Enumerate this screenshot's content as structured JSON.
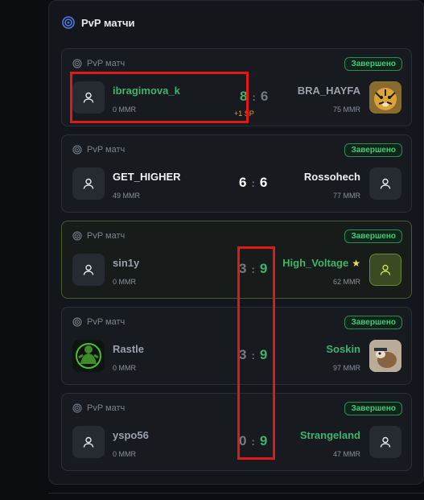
{
  "panel": {
    "title": "PvP матчи"
  },
  "matches": [
    {
      "type_label": "PvP матч",
      "status": "Завершено",
      "left": {
        "name": "ibragimova_k",
        "mmr": "0 MMR",
        "score": "8",
        "bonus": "+1 SP"
      },
      "right": {
        "name": "BRA_HAYFA",
        "mmr": "75 MMR",
        "score": "6"
      }
    },
    {
      "type_label": "PvP матч",
      "status": "Завершено",
      "left": {
        "name": "GET_HIGHER",
        "mmr": "49 MMR",
        "score": "6"
      },
      "right": {
        "name": "Rossohech",
        "mmr": "77 MMR",
        "score": "6"
      }
    },
    {
      "type_label": "PvP матч",
      "status": "Завершено",
      "left": {
        "name": "sin1y",
        "mmr": "0 MMR",
        "score": "3"
      },
      "right": {
        "name": "High_Voltage",
        "mmr": "62 MMR",
        "score": "9"
      }
    },
    {
      "type_label": "PvP матч",
      "status": "Завершено",
      "left": {
        "name": "Rastle",
        "mmr": "0 MMR",
        "score": "3"
      },
      "right": {
        "name": "Soskin",
        "mmr": "97 MMR",
        "score": "9"
      }
    },
    {
      "type_label": "PvP матч",
      "status": "Завершено",
      "left": {
        "name": "yspo56",
        "mmr": "0 MMR",
        "score": "0"
      },
      "right": {
        "name": "Strangeland",
        "mmr": "47 MMR",
        "score": "9"
      }
    }
  ],
  "colors": {
    "win": "#3fb36b",
    "accent_badge": "#3ecb7a",
    "annotation": "#e01818",
    "bonus": "#e89b3a"
  },
  "icons": {
    "header": "target-icon",
    "card": "target-icon",
    "avatar_placeholder": "user-icon",
    "favorite": "star-icon"
  }
}
